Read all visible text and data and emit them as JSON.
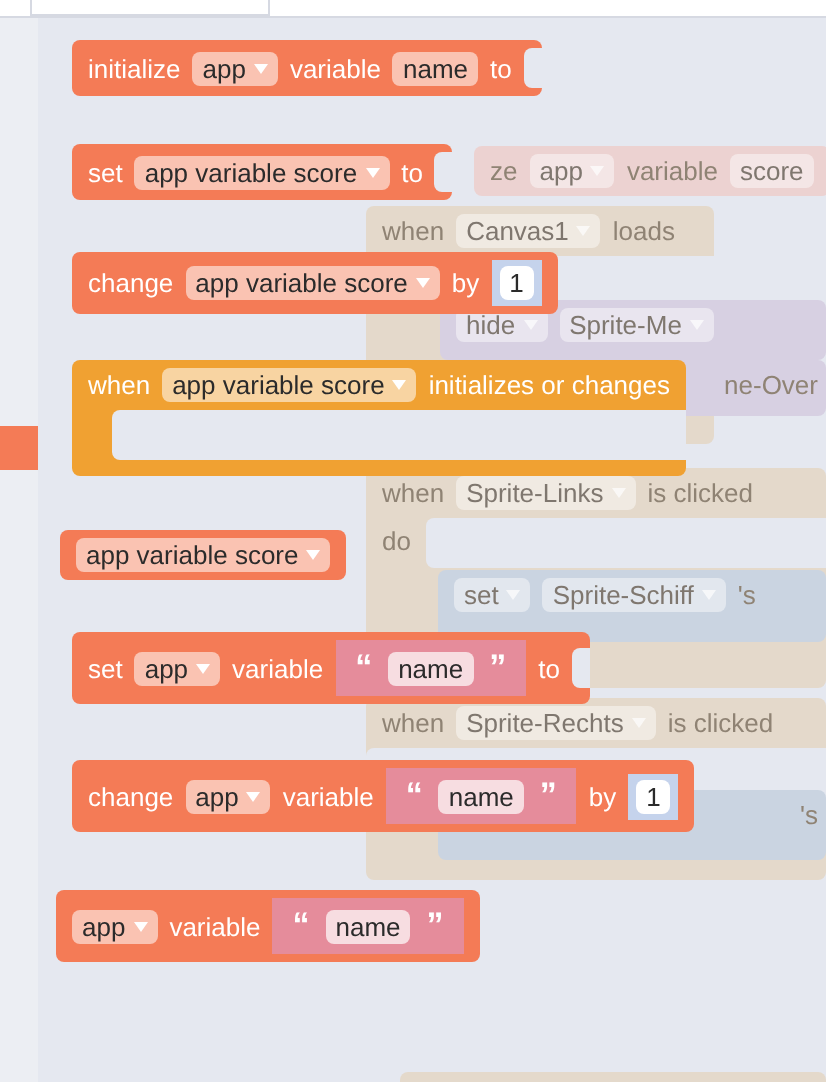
{
  "workspace": {
    "blocks": [
      {
        "kind": "statement",
        "color": "#ecd2d1",
        "parts": [
          {
            "kind": "label",
            "text": "ze"
          },
          {
            "kind": "dropdown",
            "text": "app"
          },
          {
            "kind": "label",
            "text": "variable"
          },
          {
            "kind": "field",
            "text": "score"
          }
        ]
      },
      {
        "kind": "event",
        "color": "#e4d9cb",
        "parts": [
          {
            "kind": "label",
            "text": "when"
          },
          {
            "kind": "dropdown",
            "text": "Canvas1"
          },
          {
            "kind": "label",
            "text": "loads"
          }
        ]
      },
      {
        "kind": "statement",
        "color": "#d7d0e2",
        "parts": [
          {
            "kind": "dropdown",
            "text": "hide"
          },
          {
            "kind": "dropdown",
            "text": "Sprite-Me"
          }
        ]
      },
      {
        "kind": "statement",
        "color": "#d7d0e2",
        "parts": [
          {
            "kind": "label",
            "text": "ne-Over"
          }
        ]
      },
      {
        "kind": "event",
        "color": "#e4d9cb",
        "parts": [
          {
            "kind": "label",
            "text": "when"
          },
          {
            "kind": "dropdown",
            "text": "Sprite-Links"
          },
          {
            "kind": "label",
            "text": "is clicked"
          }
        ],
        "body_label": "do"
      },
      {
        "kind": "statement",
        "color": "#cad4e1",
        "parts": [
          {
            "kind": "dropdown",
            "text": "set"
          },
          {
            "kind": "dropdown",
            "text": "Sprite-Schiff"
          },
          {
            "kind": "label",
            "text": "'s"
          }
        ]
      },
      {
        "kind": "event",
        "color": "#e4d9cb",
        "parts": [
          {
            "kind": "label",
            "text": "when"
          },
          {
            "kind": "dropdown",
            "text": "Sprite-Rechts"
          },
          {
            "kind": "label",
            "text": "is clicked"
          }
        ]
      },
      {
        "kind": "statement",
        "color": "#cad4e1",
        "parts": [
          {
            "kind": "label",
            "text": "'s"
          }
        ]
      },
      {
        "kind": "statement",
        "color": "#e4d9cb"
      }
    ]
  },
  "flyout": {
    "blocks": [
      {
        "kind": "statement",
        "color": "#f47b56",
        "parts": [
          {
            "kind": "label",
            "text": "initialize"
          },
          {
            "kind": "dropdown",
            "text": "app"
          },
          {
            "kind": "label",
            "text": "variable"
          },
          {
            "kind": "field",
            "text": "name"
          },
          {
            "kind": "label",
            "text": "to"
          },
          {
            "kind": "socket"
          }
        ]
      },
      {
        "kind": "statement",
        "color": "#f47b56",
        "parts": [
          {
            "kind": "label",
            "text": "set"
          },
          {
            "kind": "dropdown",
            "text": "app variable score"
          },
          {
            "kind": "label",
            "text": "to"
          },
          {
            "kind": "socket"
          }
        ]
      },
      {
        "kind": "statement",
        "color": "#f47b56",
        "parts": [
          {
            "kind": "label",
            "text": "change"
          },
          {
            "kind": "dropdown",
            "text": "app variable score"
          },
          {
            "kind": "label",
            "text": "by"
          },
          {
            "kind": "number",
            "text": "1"
          }
        ]
      },
      {
        "kind": "event",
        "color": "#f0a132",
        "parts": [
          {
            "kind": "label",
            "text": "when"
          },
          {
            "kind": "dropdown",
            "text": "app variable score"
          },
          {
            "kind": "label",
            "text": "initializes or changes"
          }
        ]
      },
      {
        "kind": "statement",
        "color": "#f47b56",
        "parts": [
          {
            "kind": "dropdown",
            "text": "app variable score"
          }
        ]
      },
      {
        "kind": "statement",
        "color": "#f47b56",
        "parts": [
          {
            "kind": "label",
            "text": "set"
          },
          {
            "kind": "dropdown",
            "text": "app"
          },
          {
            "kind": "label",
            "text": "variable"
          },
          {
            "kind": "string",
            "open": "“",
            "text": "name",
            "close": "”"
          },
          {
            "kind": "label",
            "text": "to"
          },
          {
            "kind": "socket"
          }
        ]
      },
      {
        "kind": "statement",
        "color": "#f47b56",
        "parts": [
          {
            "kind": "label",
            "text": "change"
          },
          {
            "kind": "dropdown",
            "text": "app"
          },
          {
            "kind": "label",
            "text": "variable"
          },
          {
            "kind": "string",
            "open": "“",
            "text": "name",
            "close": "”"
          },
          {
            "kind": "label",
            "text": "by"
          },
          {
            "kind": "number",
            "text": "1"
          }
        ]
      },
      {
        "kind": "statement",
        "color": "#f47b56",
        "parts": [
          {
            "kind": "dropdown",
            "text": "app"
          },
          {
            "kind": "label",
            "text": "variable"
          },
          {
            "kind": "string",
            "open": "“",
            "text": "name",
            "close": "”"
          }
        ]
      }
    ]
  }
}
